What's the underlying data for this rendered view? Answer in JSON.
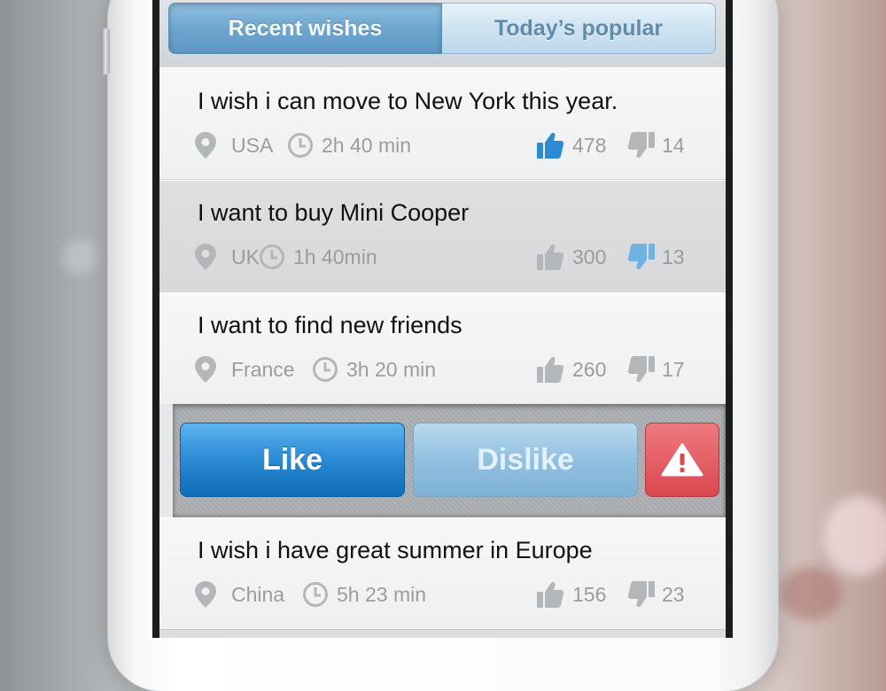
{
  "tabs": {
    "recent_label": "Recent wishes",
    "popular_label": "Today’s popular"
  },
  "wishes": [
    {
      "text": "I wish i can move to New York this year.",
      "location": "USA",
      "time": "2h 40 min",
      "likes": "478",
      "dislikes": "14",
      "liked": true,
      "disliked": false
    },
    {
      "text": "I want to buy Mini Cooper",
      "location": "UK",
      "time": "1h 40min",
      "likes": "300",
      "dislikes": "13",
      "liked": false,
      "disliked": true
    },
    {
      "text": "I want to find new friends",
      "location": "France",
      "time": "3h 20 min",
      "likes": "260",
      "dislikes": "17",
      "liked": false,
      "disliked": false
    },
    {
      "text": "I wish i have great summer in Europe",
      "location": "China",
      "time": "5h 23 min",
      "likes": "156",
      "dislikes": "23",
      "liked": false,
      "disliked": false
    }
  ],
  "actions": {
    "like_label": "Like",
    "dislike_label": "Dislike",
    "report_icon": "warning-icon"
  },
  "colors": {
    "accent_blue": "#2b8ad4",
    "report_red": "#d9474f",
    "icon_gray": "#b4b7ba"
  }
}
